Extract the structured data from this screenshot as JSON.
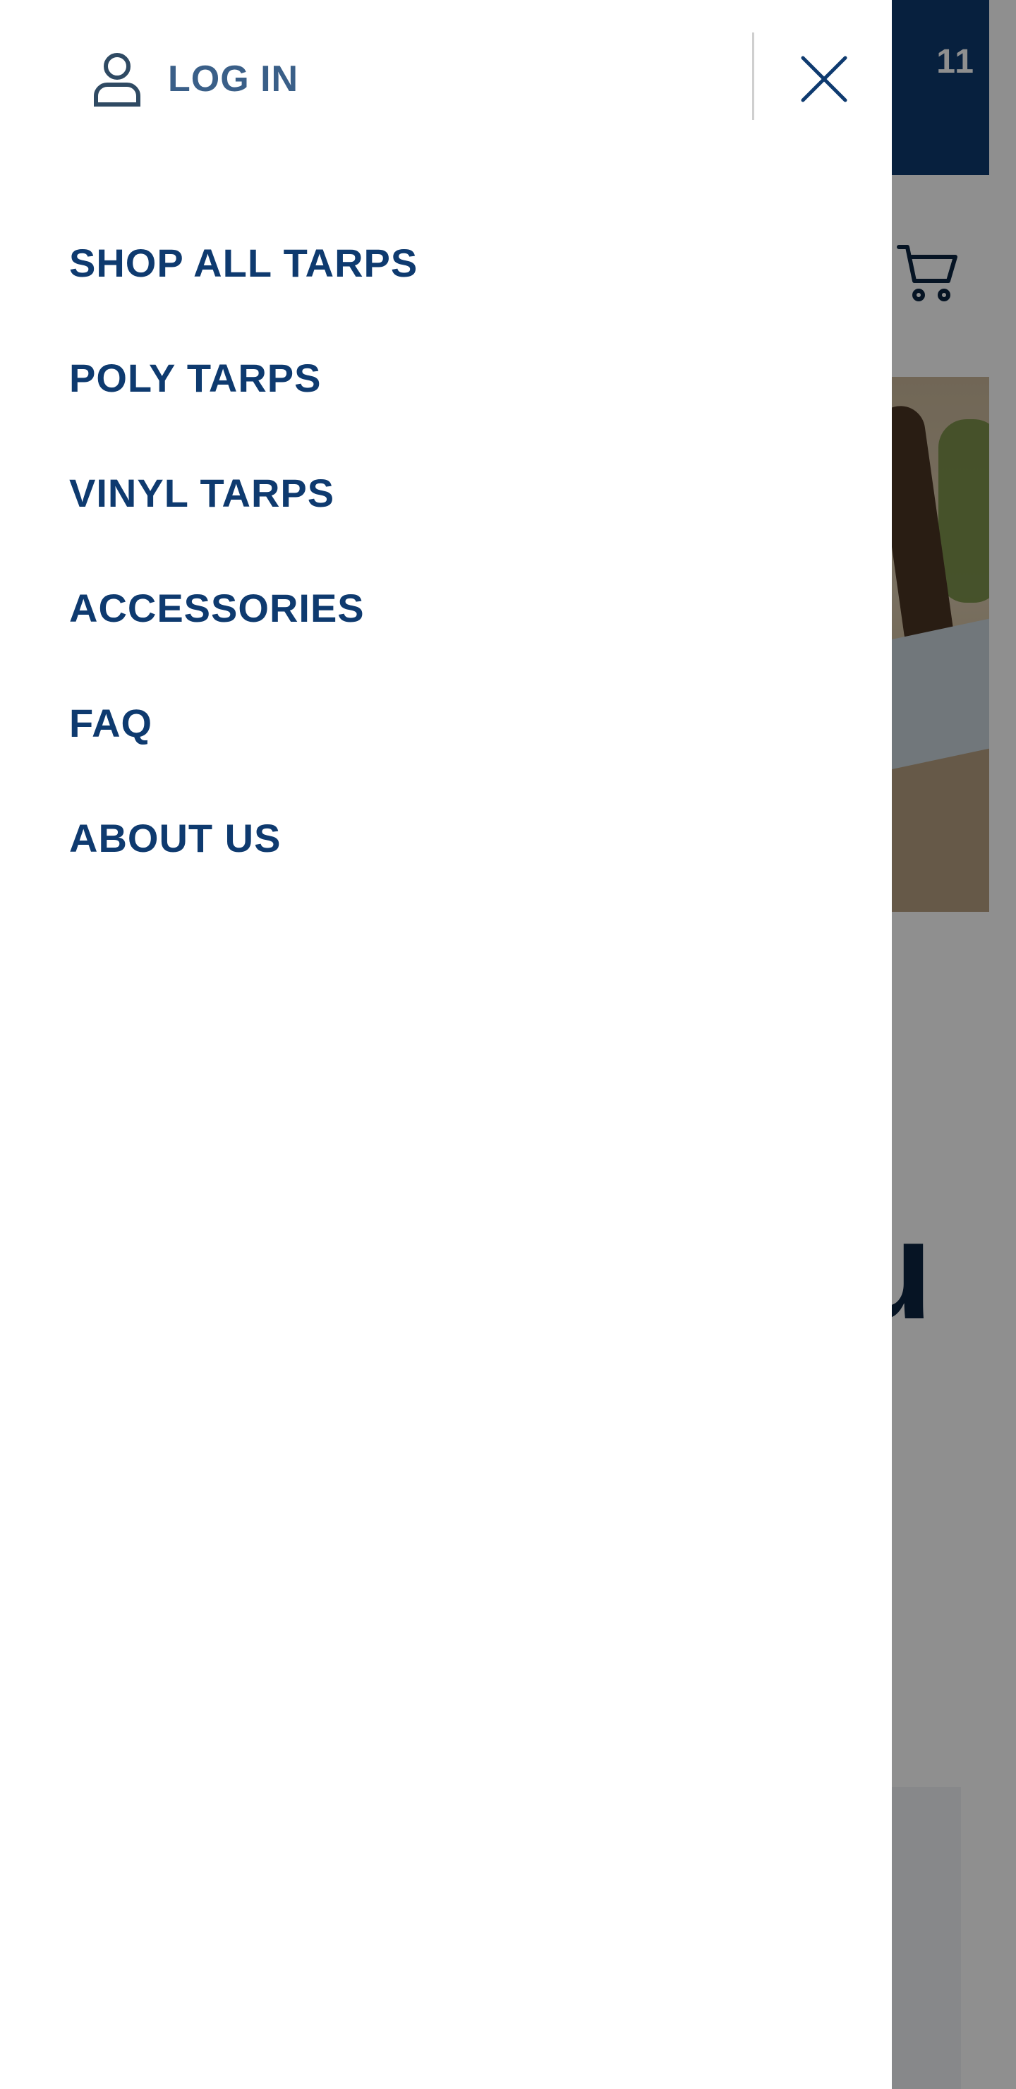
{
  "background": {
    "topbar_text": "11",
    "heading_fragment": "u",
    "icons": {
      "cart": "cart-icon"
    }
  },
  "drawer": {
    "login": {
      "label": "LOG IN",
      "icon": "user-icon"
    },
    "close": {
      "icon": "close-icon"
    },
    "nav_items": [
      {
        "label": "SHOP ALL TARPS"
      },
      {
        "label": "POLY TARPS"
      },
      {
        "label": "VINYL TARPS"
      },
      {
        "label": "ACCESSORIES"
      },
      {
        "label": "FAQ"
      },
      {
        "label": "ABOUT US"
      }
    ]
  },
  "colors": {
    "brand_navy": "#0e3a6f",
    "login_text": "#3a5f88",
    "overlay": "rgba(0,0,0,0.44)"
  }
}
